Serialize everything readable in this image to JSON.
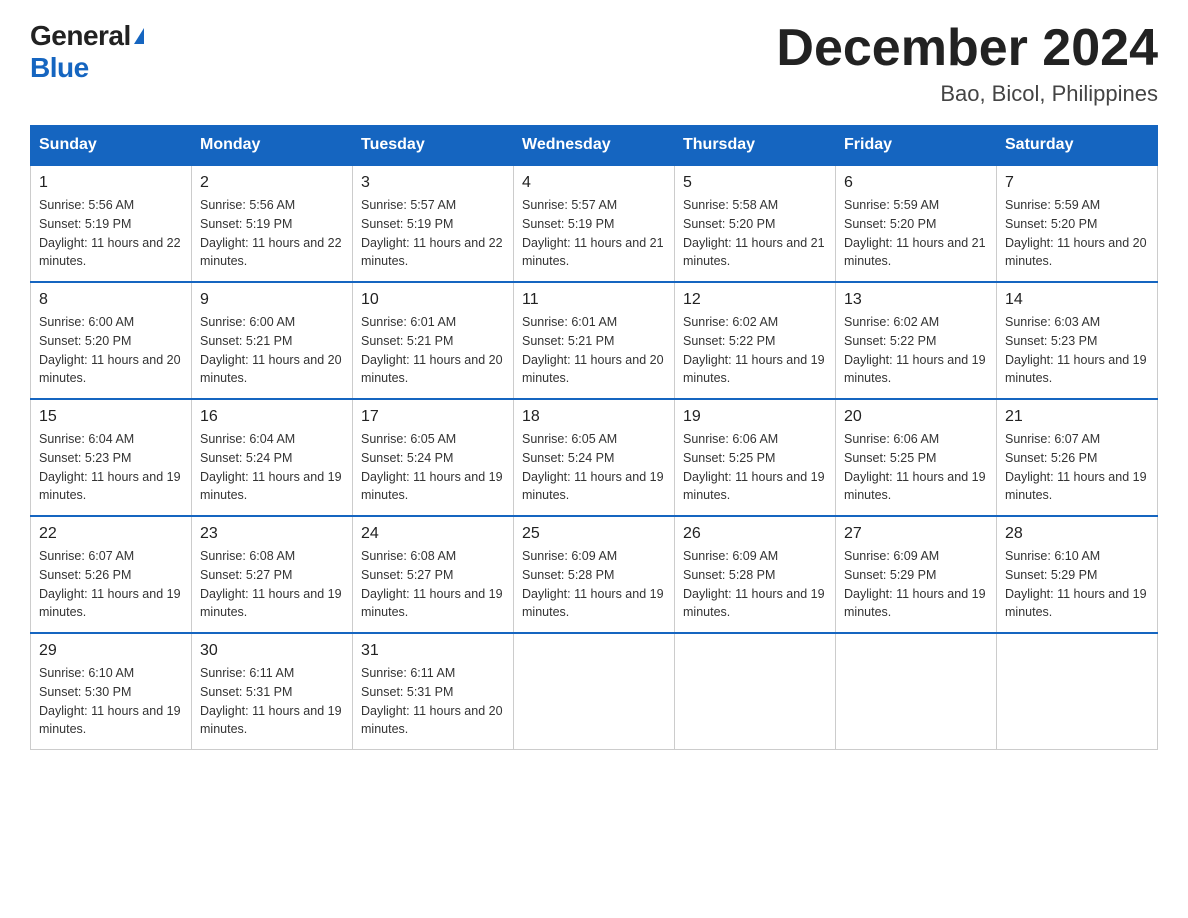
{
  "logo": {
    "general": "General",
    "blue": "Blue"
  },
  "title": "December 2024",
  "location": "Bao, Bicol, Philippines",
  "weekdays": [
    "Sunday",
    "Monday",
    "Tuesday",
    "Wednesday",
    "Thursday",
    "Friday",
    "Saturday"
  ],
  "weeks": [
    [
      {
        "day": "1",
        "sunrise": "5:56 AM",
        "sunset": "5:19 PM",
        "daylight": "11 hours and 22 minutes."
      },
      {
        "day": "2",
        "sunrise": "5:56 AM",
        "sunset": "5:19 PM",
        "daylight": "11 hours and 22 minutes."
      },
      {
        "day": "3",
        "sunrise": "5:57 AM",
        "sunset": "5:19 PM",
        "daylight": "11 hours and 22 minutes."
      },
      {
        "day": "4",
        "sunrise": "5:57 AM",
        "sunset": "5:19 PM",
        "daylight": "11 hours and 21 minutes."
      },
      {
        "day": "5",
        "sunrise": "5:58 AM",
        "sunset": "5:20 PM",
        "daylight": "11 hours and 21 minutes."
      },
      {
        "day": "6",
        "sunrise": "5:59 AM",
        "sunset": "5:20 PM",
        "daylight": "11 hours and 21 minutes."
      },
      {
        "day": "7",
        "sunrise": "5:59 AM",
        "sunset": "5:20 PM",
        "daylight": "11 hours and 20 minutes."
      }
    ],
    [
      {
        "day": "8",
        "sunrise": "6:00 AM",
        "sunset": "5:20 PM",
        "daylight": "11 hours and 20 minutes."
      },
      {
        "day": "9",
        "sunrise": "6:00 AM",
        "sunset": "5:21 PM",
        "daylight": "11 hours and 20 minutes."
      },
      {
        "day": "10",
        "sunrise": "6:01 AM",
        "sunset": "5:21 PM",
        "daylight": "11 hours and 20 minutes."
      },
      {
        "day": "11",
        "sunrise": "6:01 AM",
        "sunset": "5:21 PM",
        "daylight": "11 hours and 20 minutes."
      },
      {
        "day": "12",
        "sunrise": "6:02 AM",
        "sunset": "5:22 PM",
        "daylight": "11 hours and 19 minutes."
      },
      {
        "day": "13",
        "sunrise": "6:02 AM",
        "sunset": "5:22 PM",
        "daylight": "11 hours and 19 minutes."
      },
      {
        "day": "14",
        "sunrise": "6:03 AM",
        "sunset": "5:23 PM",
        "daylight": "11 hours and 19 minutes."
      }
    ],
    [
      {
        "day": "15",
        "sunrise": "6:04 AM",
        "sunset": "5:23 PM",
        "daylight": "11 hours and 19 minutes."
      },
      {
        "day": "16",
        "sunrise": "6:04 AM",
        "sunset": "5:24 PM",
        "daylight": "11 hours and 19 minutes."
      },
      {
        "day": "17",
        "sunrise": "6:05 AM",
        "sunset": "5:24 PM",
        "daylight": "11 hours and 19 minutes."
      },
      {
        "day": "18",
        "sunrise": "6:05 AM",
        "sunset": "5:24 PM",
        "daylight": "11 hours and 19 minutes."
      },
      {
        "day": "19",
        "sunrise": "6:06 AM",
        "sunset": "5:25 PM",
        "daylight": "11 hours and 19 minutes."
      },
      {
        "day": "20",
        "sunrise": "6:06 AM",
        "sunset": "5:25 PM",
        "daylight": "11 hours and 19 minutes."
      },
      {
        "day": "21",
        "sunrise": "6:07 AM",
        "sunset": "5:26 PM",
        "daylight": "11 hours and 19 minutes."
      }
    ],
    [
      {
        "day": "22",
        "sunrise": "6:07 AM",
        "sunset": "5:26 PM",
        "daylight": "11 hours and 19 minutes."
      },
      {
        "day": "23",
        "sunrise": "6:08 AM",
        "sunset": "5:27 PM",
        "daylight": "11 hours and 19 minutes."
      },
      {
        "day": "24",
        "sunrise": "6:08 AM",
        "sunset": "5:27 PM",
        "daylight": "11 hours and 19 minutes."
      },
      {
        "day": "25",
        "sunrise": "6:09 AM",
        "sunset": "5:28 PM",
        "daylight": "11 hours and 19 minutes."
      },
      {
        "day": "26",
        "sunrise": "6:09 AM",
        "sunset": "5:28 PM",
        "daylight": "11 hours and 19 minutes."
      },
      {
        "day": "27",
        "sunrise": "6:09 AM",
        "sunset": "5:29 PM",
        "daylight": "11 hours and 19 minutes."
      },
      {
        "day": "28",
        "sunrise": "6:10 AM",
        "sunset": "5:29 PM",
        "daylight": "11 hours and 19 minutes."
      }
    ],
    [
      {
        "day": "29",
        "sunrise": "6:10 AM",
        "sunset": "5:30 PM",
        "daylight": "11 hours and 19 minutes."
      },
      {
        "day": "30",
        "sunrise": "6:11 AM",
        "sunset": "5:31 PM",
        "daylight": "11 hours and 19 minutes."
      },
      {
        "day": "31",
        "sunrise": "6:11 AM",
        "sunset": "5:31 PM",
        "daylight": "11 hours and 20 minutes."
      },
      null,
      null,
      null,
      null
    ]
  ],
  "labels": {
    "sunrise": "Sunrise:",
    "sunset": "Sunset:",
    "daylight": "Daylight:"
  }
}
